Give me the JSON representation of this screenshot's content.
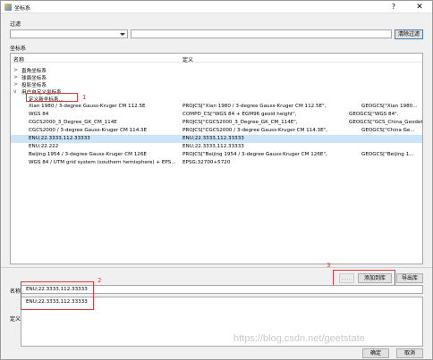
{
  "window": {
    "title": "坐标系",
    "help": "?",
    "close": "✕"
  },
  "filter": {
    "label": "过滤",
    "combo_value": "",
    "input_value": "",
    "button": "清除过滤"
  },
  "crs_label": "坐标系",
  "tree": {
    "col_name": "名称",
    "col_def": "定义",
    "groups": [
      "直角坐标系",
      "球面坐标系",
      "投影坐标系",
      "用户自定义坐标系"
    ],
    "new_item": "定义新坐标系...",
    "rows": [
      {
        "name": "Xian 1980 / 3-degree Gauss-Kruger CM 112.5E",
        "def": "PROJCS[\"Xian 1980 / 3-degree Gauss-Kruger CM 112.5E\",",
        "geo": "GEOGCS[\"Xian 1980..."
      },
      {
        "name": "WGS 84",
        "def": "COMPD_CS[\"WGS 84 + EGM96 geoid height\",",
        "geo": "GEOGCS[\"WGS 84\","
      },
      {
        "name": "CGCS2000_3_Degree_GK_CM_114E",
        "def": "PROJCS[\"CGCS2000_3_Degree_GK_CM_114E\",",
        "geo": "GEOGCS[\"GCS_China_Geodetic..."
      },
      {
        "name": "CGCS2000 / 3-degree Gauss-Kruger CM 114.3E",
        "def": "PROJCS[\"CGCS2000 / 3-degree Gauss-Kruger CM 114.3E\",",
        "geo": "GEOGCS[\"China Ge..."
      },
      {
        "name": "ENU;22.3333,112.33333",
        "def": "ENU;22.3333,112.33333",
        "geo": ""
      },
      {
        "name": "ENU;22.222",
        "def": "ENU;22.3333,112.33333",
        "geo": ""
      },
      {
        "name": "Beijing 1954 / 3-degree Gauss-Kruger CM 126E",
        "def": "PROJCS[\"Beijing 1954 / 3-degree Gauss-Kruger CM 126E\",",
        "geo": "GEOGCS[\"Beijing 1..."
      },
      {
        "name": "WGS 84 / UTM grid system (southern hemisphere) + EPS...",
        "def": "EPSG:32700+5720",
        "geo": ""
      }
    ],
    "selected_index": 4
  },
  "annotations": {
    "n1": "1",
    "n2": "2",
    "n3": "3"
  },
  "actions": {
    "disabled_btn": "......",
    "add_btn": "添加到库",
    "export_btn": "导出库"
  },
  "name_field": {
    "label": "名称",
    "value": "ENU;22.3333,112.33333"
  },
  "def_field": {
    "label": "定义",
    "value": "ENU;22.3333,112.33333"
  },
  "footer": {
    "ok": "确定",
    "cancel": "取消",
    "watermark": "https://blog.csdn.net/geetstate"
  },
  "colors": {
    "selection": "#cce4f7",
    "annotation_red": "#e23a3a"
  }
}
